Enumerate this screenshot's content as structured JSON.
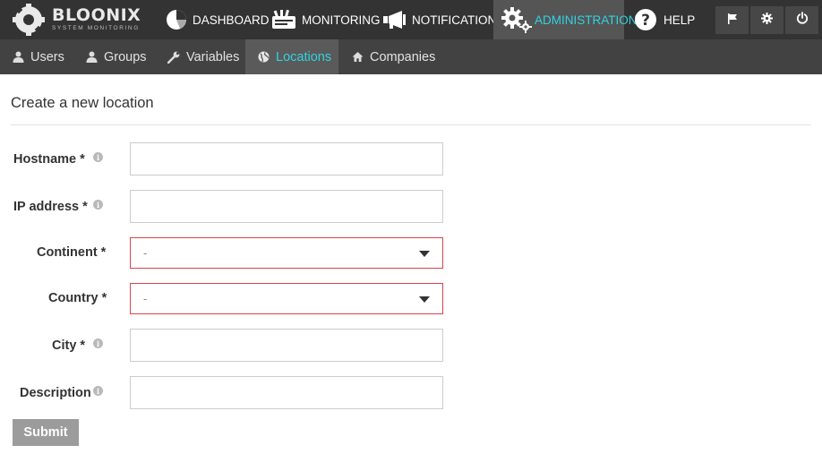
{
  "brand": {
    "name": "BLOONIX",
    "tagline": "SYSTEM MONITORING"
  },
  "topnav": [
    {
      "label": "DASHBOARD",
      "icon": "pie-chart-icon"
    },
    {
      "label": "MONITORING",
      "icon": "monitoring-icon"
    },
    {
      "label": "NOTIFICATIONS",
      "icon": "megaphone-icon"
    },
    {
      "label": "ADMINISTRATION",
      "icon": "gears-icon",
      "active": true
    },
    {
      "label": "HELP",
      "icon": "question-circle-icon"
    }
  ],
  "top_actions": [
    {
      "icon": "flag-icon"
    },
    {
      "icon": "gear-icon"
    },
    {
      "icon": "power-icon"
    }
  ],
  "subnav": [
    {
      "label": "Users",
      "icon": "user-icon"
    },
    {
      "label": "Groups",
      "icon": "user-icon"
    },
    {
      "label": "Variables",
      "icon": "wrench-icon"
    },
    {
      "label": "Locations",
      "icon": "globe-icon",
      "active": true
    },
    {
      "label": "Companies",
      "icon": "home-icon"
    }
  ],
  "form": {
    "title": "Create a new location",
    "hostname_label": "Hostname *",
    "hostname_value": "",
    "ip_label": "IP address *",
    "ip_value": "",
    "continent_label": "Continent *",
    "continent_value": "-",
    "country_label": "Country *",
    "country_value": "-",
    "city_label": "City *",
    "city_value": "",
    "description_label": "Description",
    "description_value": "",
    "info_glyph": "i",
    "submit_label": "Submit"
  },
  "colors": {
    "topbar": "#333333",
    "subbar": "#424242",
    "active_text": "#2fd3e0",
    "invalid_border": "#d6444a",
    "submit_bg": "#9c9c9c"
  }
}
